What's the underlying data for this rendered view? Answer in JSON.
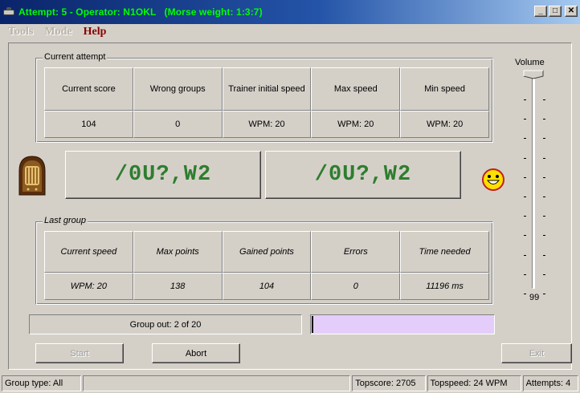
{
  "window": {
    "title": "Attempt: 5 - Operator: N1OKL   (Morse weight: 1:3:7)",
    "buttons": {
      "minimize": "_",
      "maximize": "□",
      "close": "✕"
    }
  },
  "menu": [
    {
      "label": "Tools",
      "enabled": false
    },
    {
      "label": "Mode",
      "enabled": false
    },
    {
      "label": "Help",
      "enabled": true
    }
  ],
  "current_attempt": {
    "legend": "Current attempt",
    "headers": [
      "Current score",
      "Wrong groups",
      "Trainer initial speed",
      "Max speed",
      "Min speed"
    ],
    "values": [
      "104",
      "0",
      "WPM: 20",
      "WPM: 20",
      "WPM: 20"
    ]
  },
  "morse": {
    "sent": "/0U?,W2",
    "received": "/0U?,W2"
  },
  "last_group": {
    "legend": "Last group",
    "headers": [
      "Current speed",
      "Max points",
      "Gained points",
      "Errors",
      "Time needed"
    ],
    "values": [
      "WPM: 20",
      "138",
      "104",
      "0",
      "11196 ms"
    ]
  },
  "group_out": "Group out: 2 of 20",
  "progress": {
    "fraction": 0.0
  },
  "buttons": {
    "start": "Start",
    "abort": "Abort",
    "exit": "Exit"
  },
  "volume": {
    "label": "Volume",
    "value": "99"
  },
  "statusbar": {
    "group_type": "Group type: All",
    "blank": "",
    "topscore": "Topscore: 2705",
    "topspeed": "Topspeed: 24 WPM",
    "attempts": "Attempts: 4"
  },
  "colors": {
    "title_text": "#00ff00",
    "morse_text": "#2e7d2e",
    "help_menu": "#8b0000",
    "progress_fill": "#e4cdfa"
  },
  "icons": [
    "app-morse-key-icon",
    "antique-radio-icon",
    "smiley-face-icon"
  ]
}
